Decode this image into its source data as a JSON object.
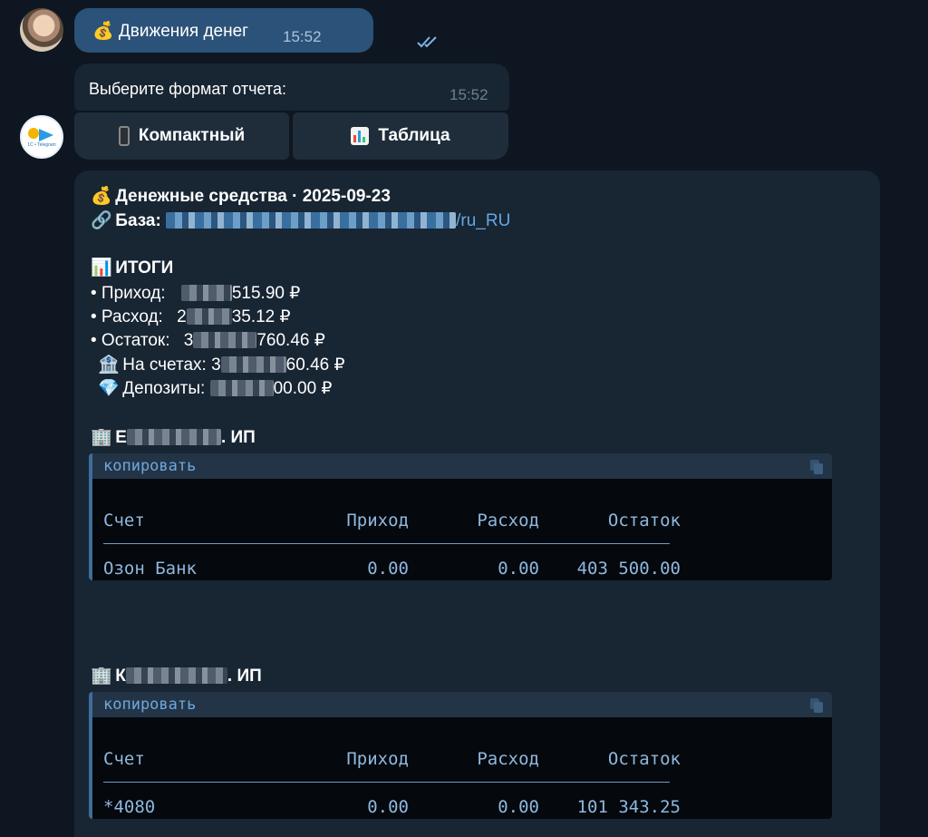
{
  "outgoing": {
    "text": "💰 Движения денег",
    "time": "15:52"
  },
  "prompt": {
    "text": "Выберите формат отчета:",
    "time": "15:52"
  },
  "keyboard": {
    "compact": "Компактный",
    "table": "Таблица"
  },
  "report": {
    "title": "Денежные средства · 2025-09-23",
    "base_label": "База:",
    "base_suffix": "/ru_RU",
    "totals_heading": "ИТОГИ",
    "income_label": "• Приход:",
    "income_tail": "515.90 ₽",
    "expense_label": "• Расход:",
    "expense_head": "2",
    "expense_tail": "35.12 ₽",
    "balance_label": "• Остаток:",
    "balance_head": "3",
    "balance_tail": "760.46 ₽",
    "accounts_label": "На счетах:",
    "accounts_head": "3",
    "accounts_tail": "60.46 ₽",
    "deposits_label": "Депозиты:",
    "deposits_tail": "00.00 ₽",
    "companies": [
      {
        "name_head": "Е",
        "name_tail": ". ИП",
        "copy": "копировать",
        "headers": [
          "Счет",
          "Приход",
          "Расход",
          "Остаток"
        ],
        "row": [
          "Озон Банк",
          "0.00",
          "0.00",
          "403 500.00"
        ]
      },
      {
        "name_head": "К",
        "name_tail": ". ИП",
        "copy": "копировать",
        "headers": [
          "Счет",
          "Приход",
          "Расход",
          "Остаток"
        ],
        "row": [
          "*4080",
          "0.00",
          "0.00",
          "101 343.25"
        ]
      }
    ]
  }
}
